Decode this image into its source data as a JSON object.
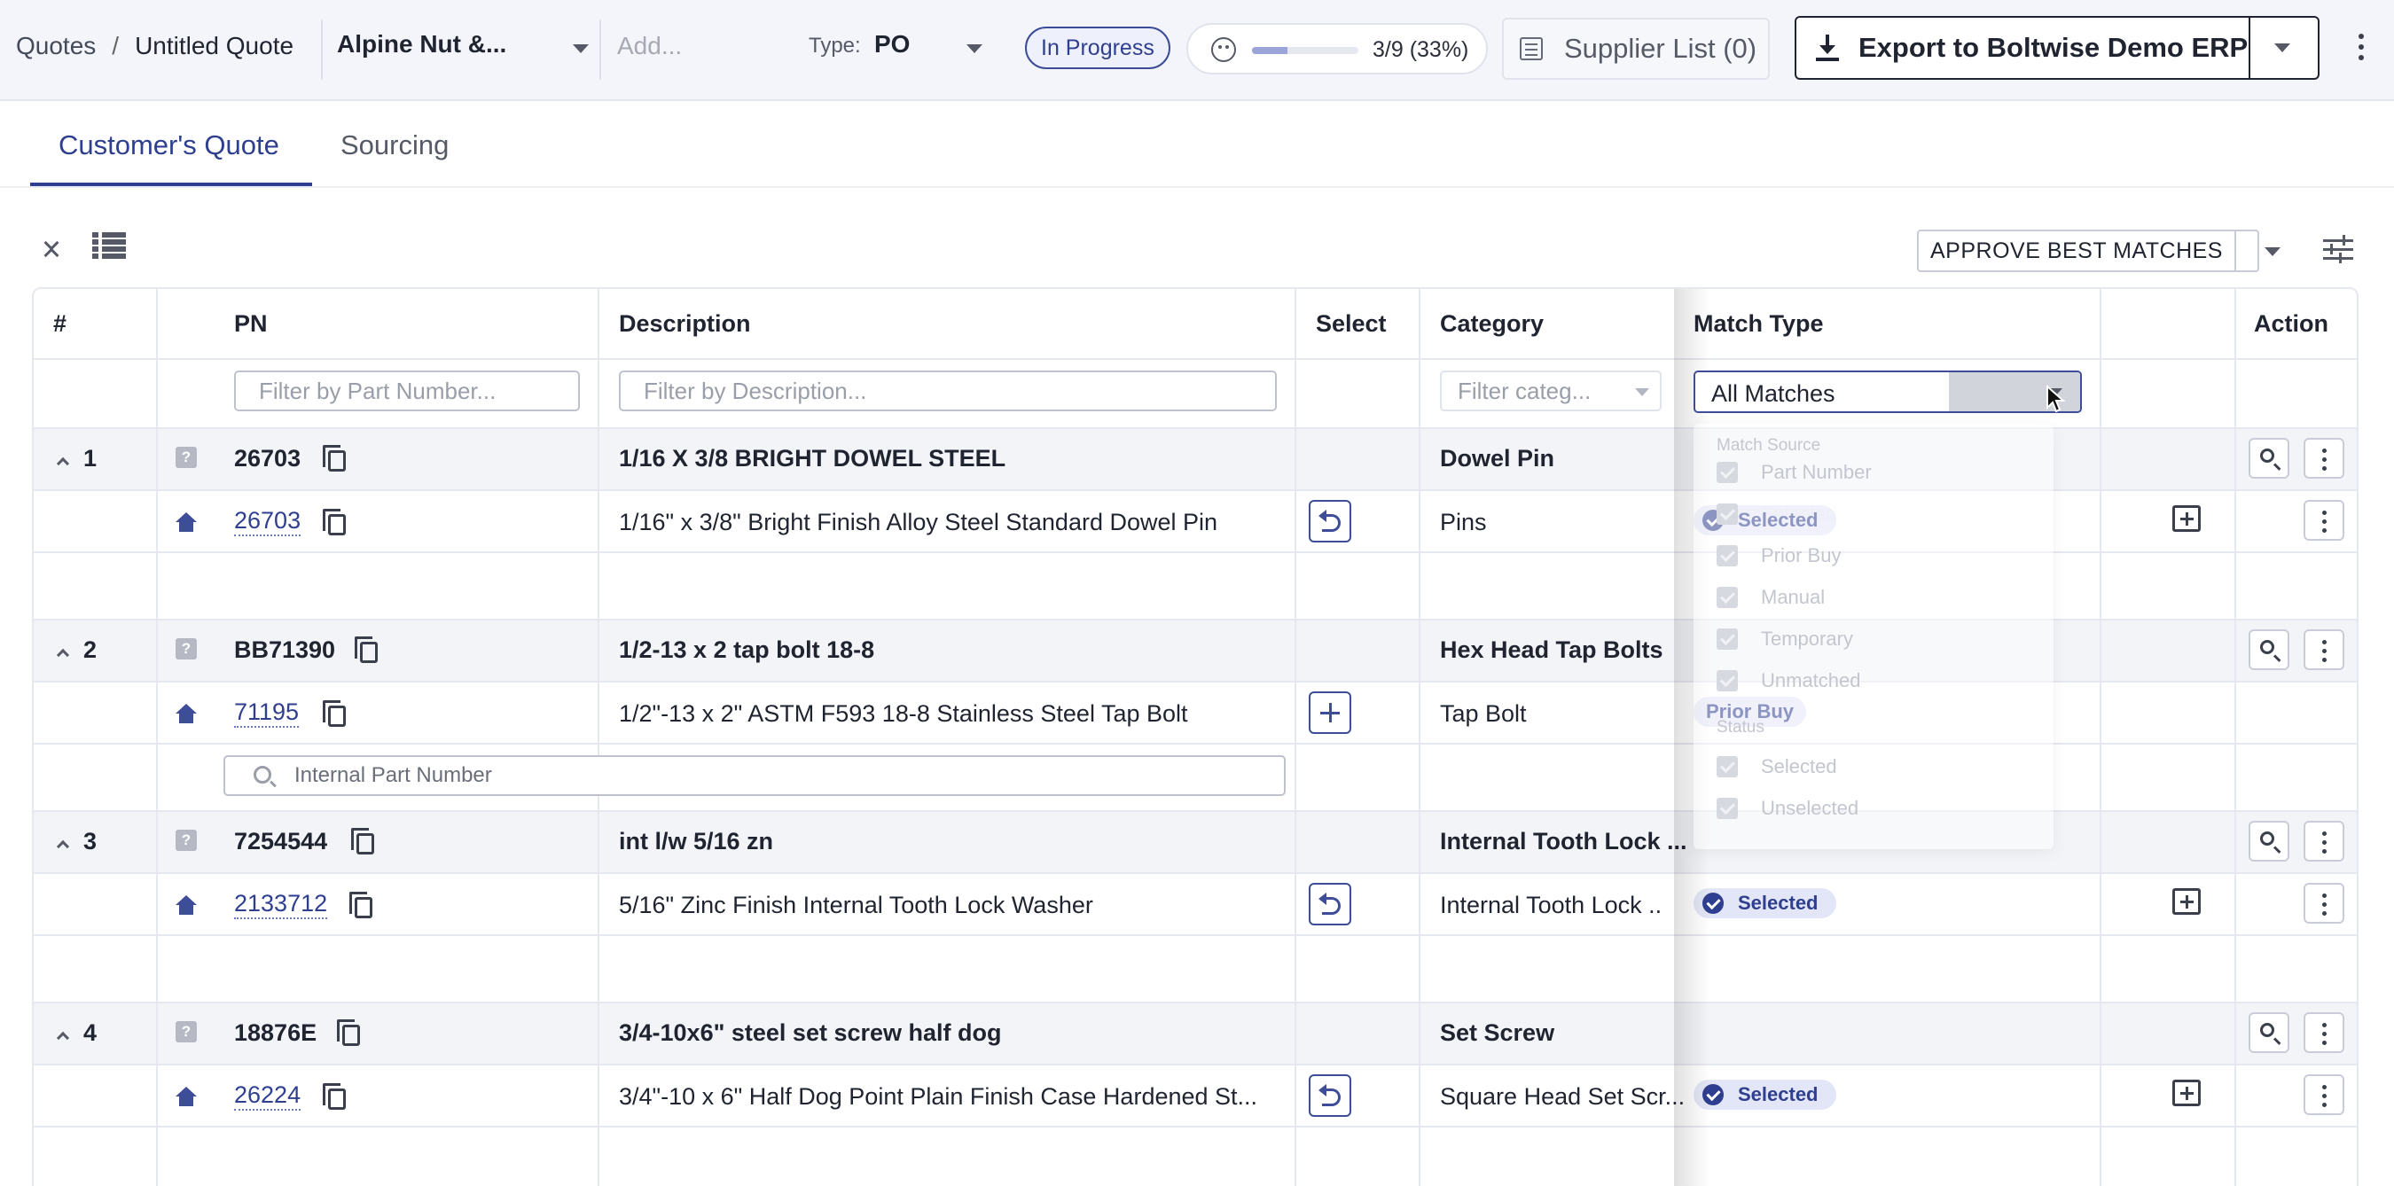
{
  "header": {
    "breadcrumb_root": "Quotes",
    "breadcrumb_sep": "/",
    "breadcrumb_current": "Untitled Quote",
    "supplier": "Alpine Nut &...",
    "add_placeholder": "Add...",
    "type_label": "Type:",
    "type_value": "PO",
    "status": "In Progress",
    "progress_text": "3/9 (33%)",
    "progress_fraction": 0.33,
    "supplier_list": "Supplier List (0)",
    "export_label": "Export to Boltwise Demo ERP"
  },
  "tabs": [
    {
      "label": "Customer's Quote",
      "active": true
    },
    {
      "label": "Sourcing",
      "active": false
    }
  ],
  "toolbar": {
    "approve_label": "APPROVE BEST MATCHES"
  },
  "table": {
    "headers": {
      "num": "#",
      "pn": "PN",
      "description": "Description",
      "select": "Select",
      "category": "Category",
      "match_type": "Match Type",
      "action": "Action"
    },
    "filters": {
      "pn_placeholder": "Filter by Part Number...",
      "desc_placeholder": "Filter by Description...",
      "category_placeholder": "Filter categ...",
      "match_type_value": "All Matches"
    },
    "rows": [
      {
        "num": "1",
        "parent_pn": "26703",
        "parent_desc": "1/16 X 3/8 BRIGHT DOWEL STEEL",
        "parent_category": "Dowel Pin",
        "child_pn": "26703",
        "child_desc": "1/16\" x 3/8\" Bright Finish Alloy Steel Standard Dowel Pin",
        "child_category": "Pins",
        "match_badge": "Selected"
      },
      {
        "num": "2",
        "parent_pn": "BB71390",
        "parent_desc": "1/2-13 x 2 tap bolt 18-8",
        "parent_category": "Hex Head Tap Bolts",
        "child_pn": "71195",
        "child_desc": "1/2\"-13 x 2\" ASTM F593 18-8 Stainless Steel Tap Bolt",
        "child_category": "Tap Bolt",
        "match_badge": "Prior Buy",
        "internal_pn_placeholder": "Internal Part Number"
      },
      {
        "num": "3",
        "parent_pn": "7254544",
        "parent_desc": "int l/w 5/16 zn",
        "parent_category": "Internal Tooth Lock ...",
        "child_pn": "2133712",
        "child_desc": "5/16\" Zinc Finish Internal Tooth Lock Washer",
        "child_category": "Internal Tooth Lock ...",
        "match_badge": "Selected"
      },
      {
        "num": "4",
        "parent_pn": "18876E",
        "parent_desc": "3/4-10x6\" steel set screw half dog",
        "parent_category": "Set Screw",
        "child_pn": "26224",
        "child_desc": "3/4\"-10 x 6\" Half Dog Point Plain Finish Case Hardened St...",
        "child_category": "Square Head Set Scr...",
        "match_badge": "Selected"
      }
    ]
  },
  "match_menu": {
    "group_source": "Match Source",
    "sources": [
      "Part Number",
      "Selected",
      "Prior Buy",
      "Manual",
      "Temporary",
      "Unmatched"
    ],
    "group_status": "Status",
    "statuses": [
      "Selected",
      "Unselected"
    ]
  },
  "icons": {
    "copy": "copy-icon",
    "home": "home-icon",
    "question": "question-icon",
    "undo": "undo-icon",
    "plus": "plus-icon",
    "note": "add-note-icon",
    "search": "search-icon",
    "kebab": "more-vertical-icon"
  },
  "colors": {
    "accent": "#2f3f8f",
    "badge_bg": "#e3e6f6",
    "header_bg": "#f4f5fa",
    "parent_row_bg": "#f3f4f8"
  }
}
